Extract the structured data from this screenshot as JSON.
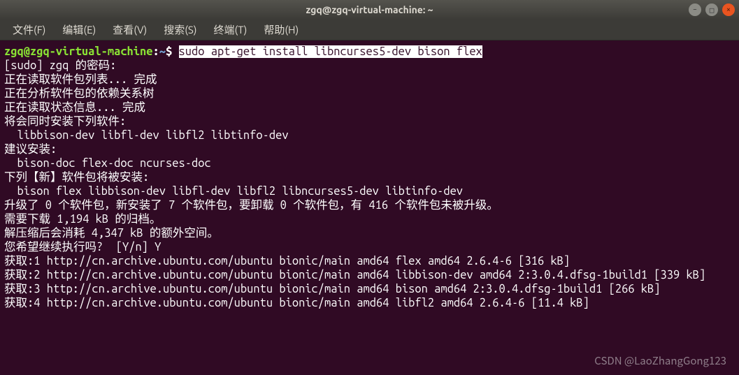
{
  "window": {
    "title": "zgq@zgq-virtual-machine: ~"
  },
  "menu": {
    "file": "文件(F)",
    "edit": "编辑(E)",
    "view": "查看(V)",
    "search": "搜索(S)",
    "terminal": "终端(T)",
    "help": "帮助(H)"
  },
  "prompt": {
    "userhost": "zgq@zgq-virtual-machine",
    "colon": ":",
    "path": "~",
    "dollar": "$ "
  },
  "command": "sudo apt-get install libncurses5-dev bison flex",
  "lines": {
    "l1": "[sudo] zgq 的密码:",
    "l2": "正在读取软件包列表... 完成",
    "l3": "正在分析软件包的依赖关系树",
    "l4": "正在读取状态信息... 完成",
    "l5": "将会同时安装下列软件:",
    "l6": "  libbison-dev libfl-dev libfl2 libtinfo-dev",
    "l7": "建议安装:",
    "l8": "  bison-doc flex-doc ncurses-doc",
    "l9": "下列【新】软件包将被安装:",
    "l10": "  bison flex libbison-dev libfl-dev libfl2 libncurses5-dev libtinfo-dev",
    "l11": "升级了 0 个软件包，新安装了 7 个软件包，要卸载 0 个软件包，有 416 个软件包未被升级。",
    "l12": "需要下载 1,194 kB 的归档。",
    "l13": "解压缩后会消耗 4,347 kB 的额外空间。",
    "l14": "您希望继续执行吗?  [Y/n] Y",
    "l15": "获取:1 http://cn.archive.ubuntu.com/ubuntu bionic/main amd64 flex amd64 2.6.4-6 [316 kB]",
    "l16": "获取:2 http://cn.archive.ubuntu.com/ubuntu bionic/main amd64 libbison-dev amd64 2:3.0.4.dfsg-1build1 [339 kB]",
    "l17": "获取:3 http://cn.archive.ubuntu.com/ubuntu bionic/main amd64 bison amd64 2:3.0.4.dfsg-1build1 [266 kB]",
    "l18": "获取:4 http://cn.archive.ubuntu.com/ubuntu bionic/main amd64 libfl2 amd64 2.6.4-6 [11.4 kB]"
  },
  "watermark": "CSDN @LaoZhangGong123"
}
